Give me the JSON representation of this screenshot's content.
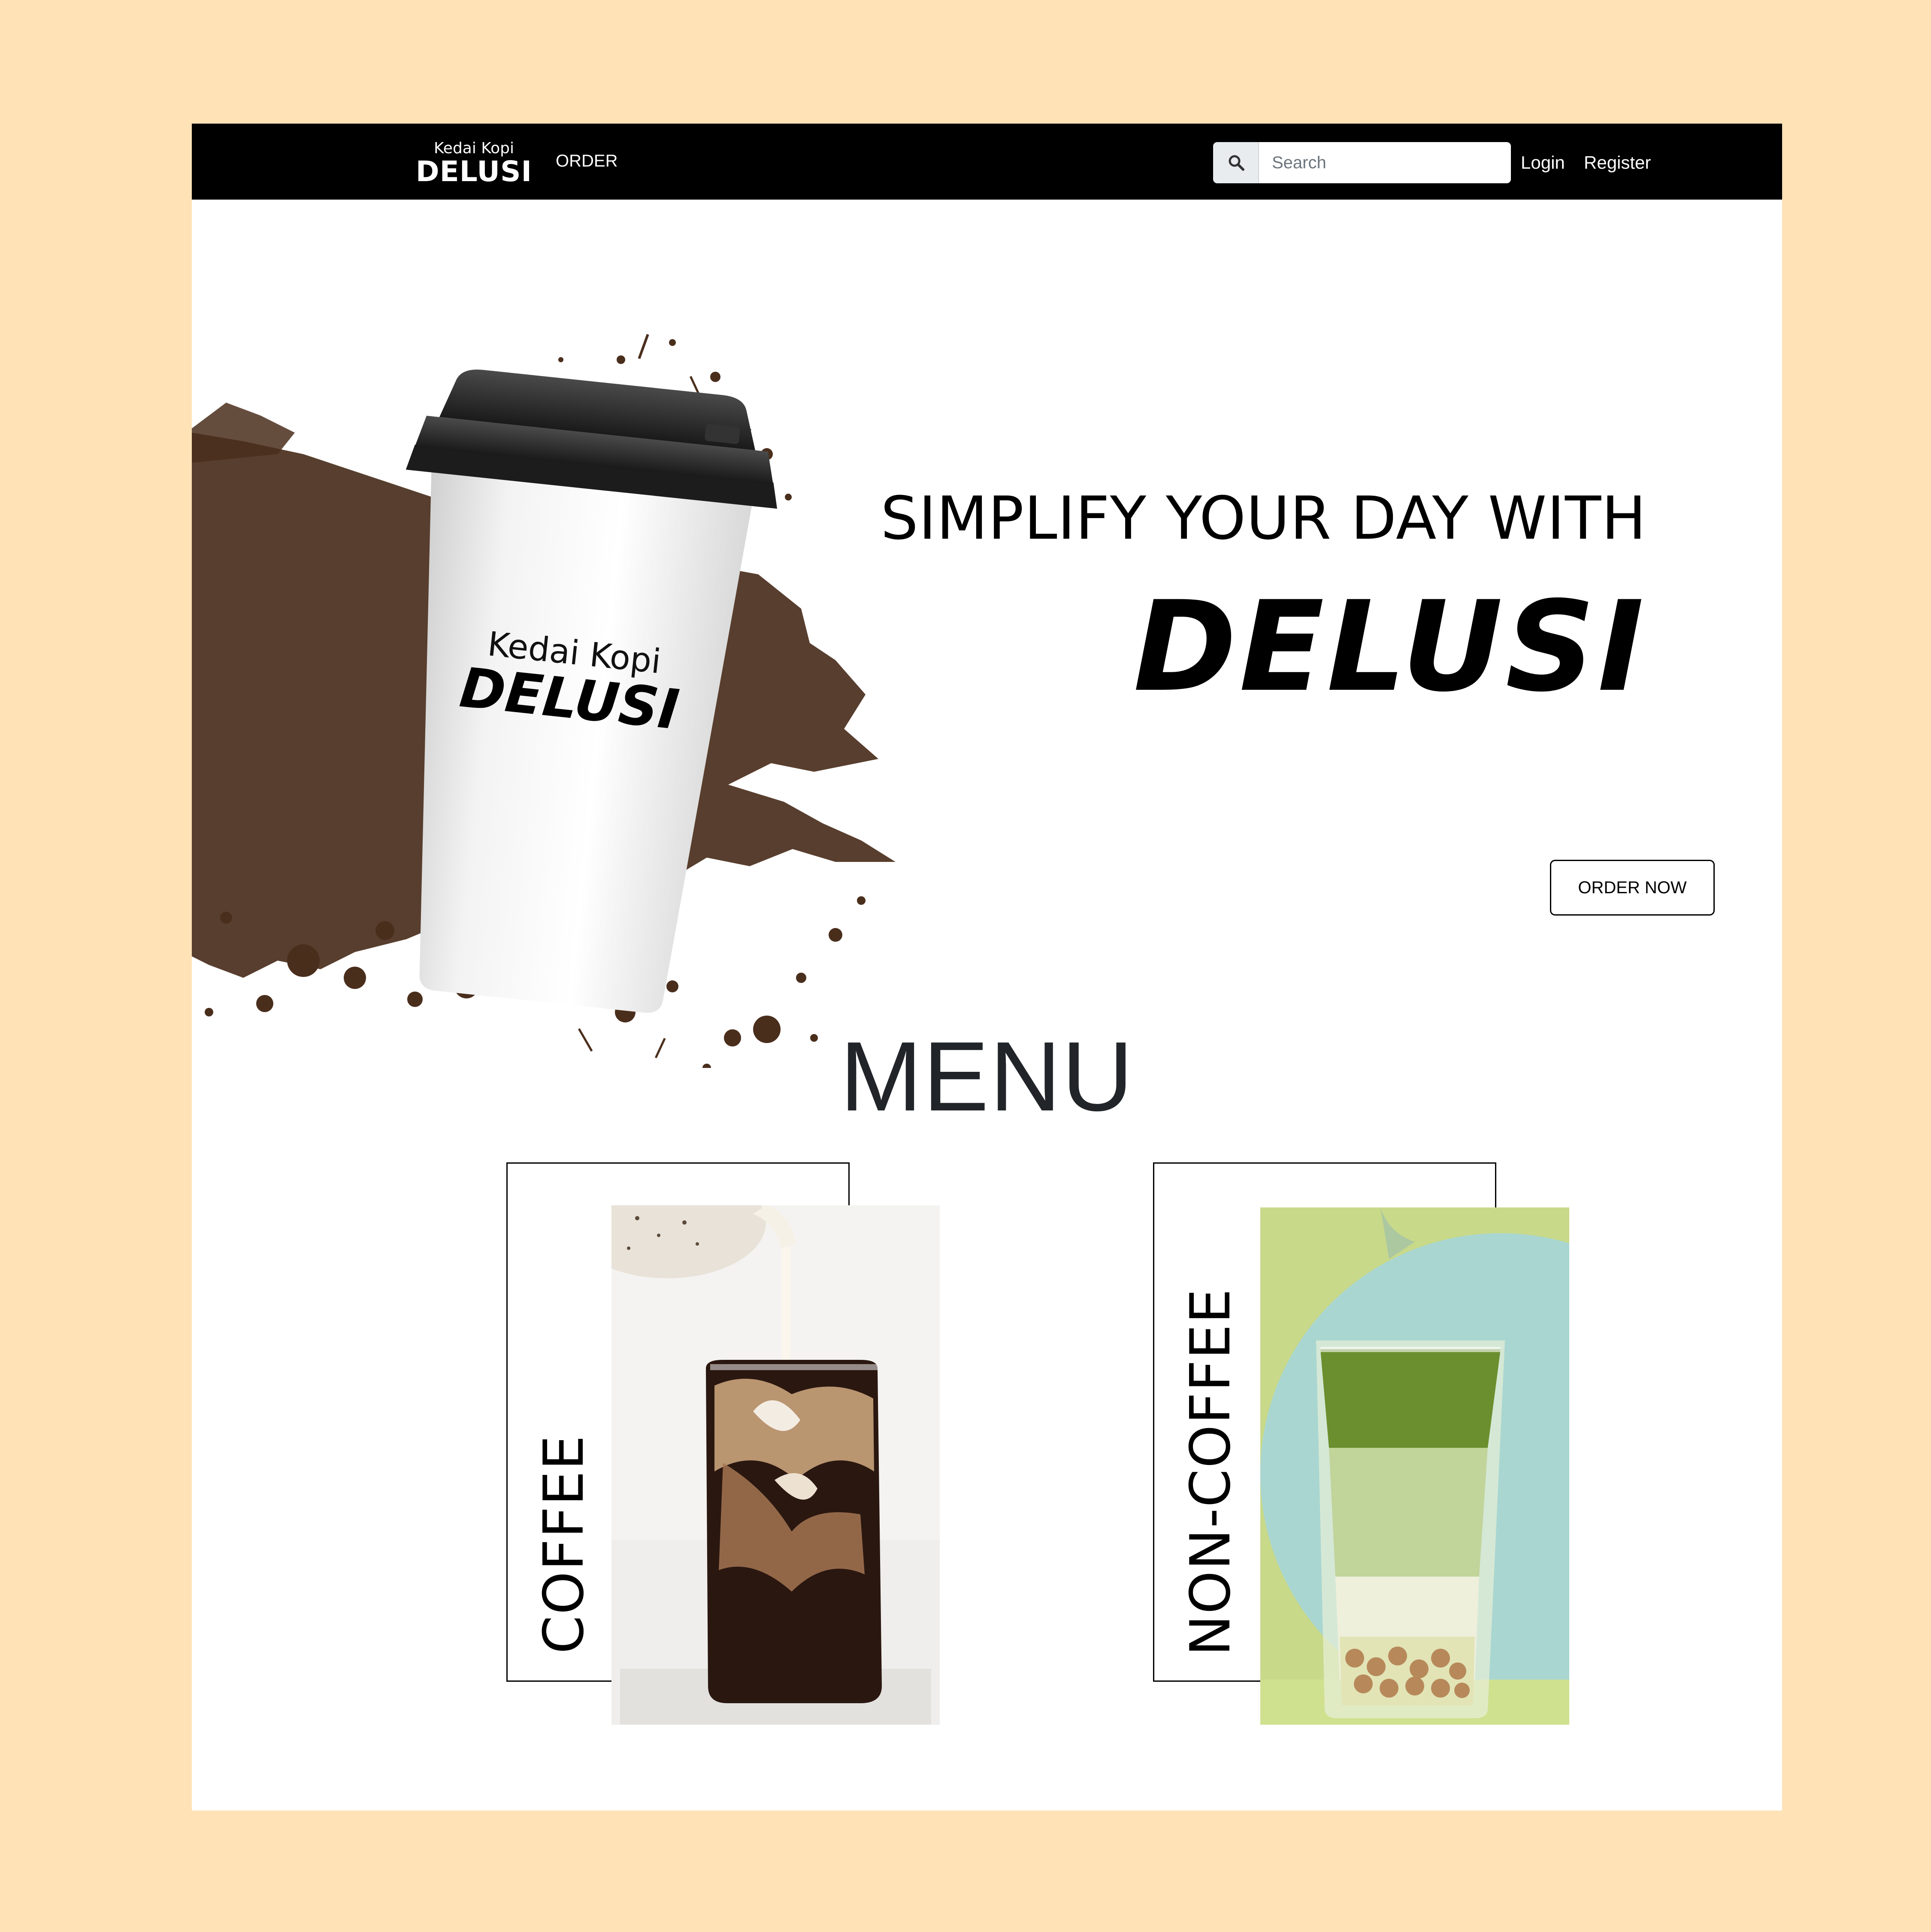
{
  "navbar": {
    "brand_small": "Kedai Kopi",
    "brand_big": "DELUSI",
    "order_link": "ORDER",
    "search_placeholder": "Search",
    "login_link": "Login",
    "register_link": "Register"
  },
  "hero": {
    "line1": "SIMPLIFY YOUR DAY WITH",
    "line2": "DELUSI",
    "cup_brand_small": "Kedai Kopi",
    "cup_brand_big": "DELUSI",
    "order_button": "ORDER NOW"
  },
  "menu": {
    "title": "MENU",
    "cards": [
      {
        "label": "COFFEE",
        "photo": "iced-latte-photo"
      },
      {
        "label": "NON-COFFEE",
        "photo": "matcha-boba-photo"
      }
    ]
  },
  "colors": {
    "background": "#FFE2B6",
    "navbar": "#000000",
    "coffee_splash": "#4a2e1c",
    "menu_title": "#212529"
  }
}
